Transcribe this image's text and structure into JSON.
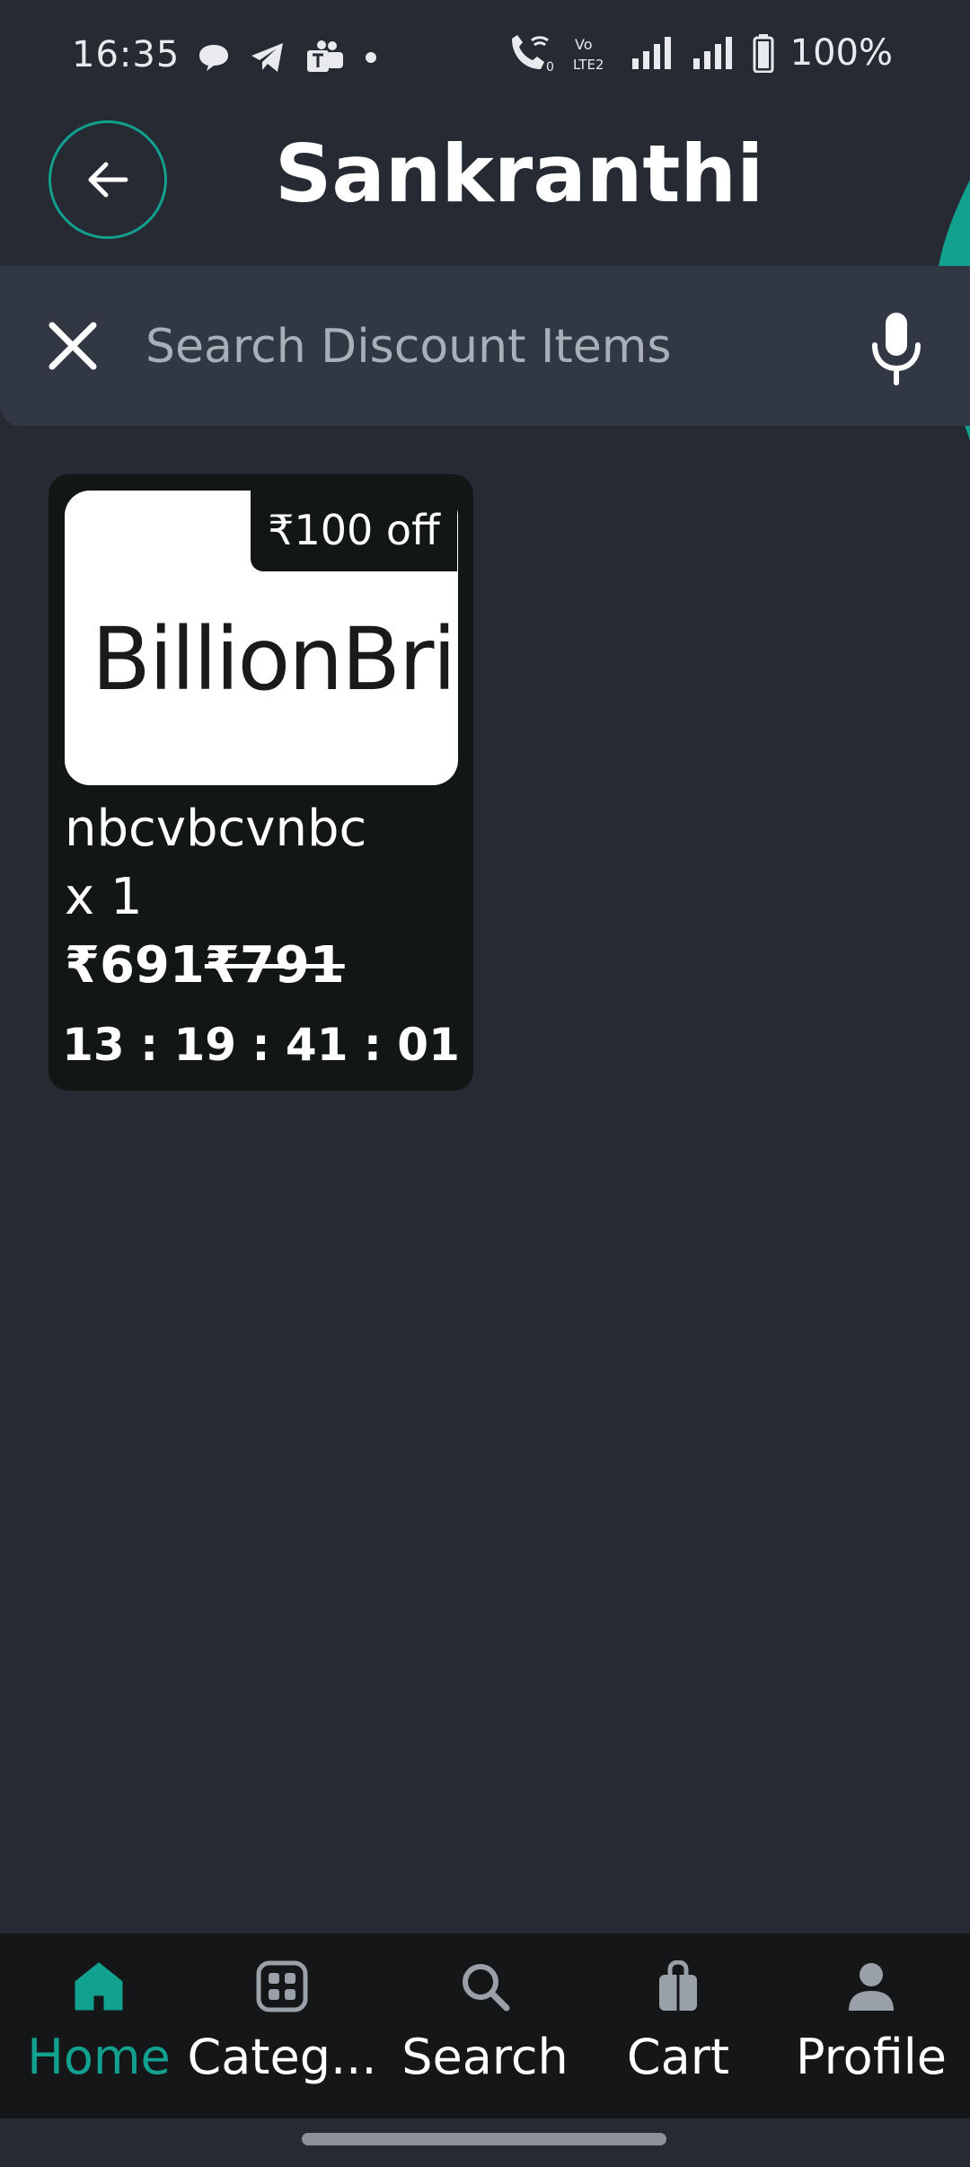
{
  "status_bar": {
    "time": "16:35",
    "battery": "100%",
    "icons": [
      "chat-bubble-icon",
      "telegram-icon",
      "teams-icon",
      "dot-icon",
      "wifi-call-icon",
      "volte-icon",
      "signal-icon",
      "signal-icon",
      "battery-icon"
    ]
  },
  "header": {
    "title": "Sankranthi",
    "back_icon": "arrow-left-icon"
  },
  "search": {
    "placeholder": "Search Discount Items",
    "value": "",
    "clear_icon": "close-icon",
    "voice_icon": "microphone-icon"
  },
  "products": [
    {
      "image_text": "BillionBrig",
      "badge": "₹100 off",
      "name": "nbcvbcvnbc",
      "quantity": "x 1",
      "price": "₹691",
      "original_price": "₹791",
      "countdown": "13 : 19 : 41 : 01"
    }
  ],
  "bottom_nav": {
    "items": [
      {
        "label": "Home",
        "icon": "home-icon",
        "active": true
      },
      {
        "label": "Categ...",
        "icon": "grid-icon",
        "active": false
      },
      {
        "label": "Search",
        "icon": "search-icon",
        "active": false
      },
      {
        "label": "Cart",
        "icon": "shopping-bag-icon",
        "active": false
      },
      {
        "label": "Profile",
        "icon": "person-icon",
        "active": false
      }
    ]
  },
  "colors": {
    "background": "#252a33",
    "search_bar": "#313843",
    "card": "#121716",
    "accent": "#12a08f",
    "nav_bar": "#141617"
  }
}
